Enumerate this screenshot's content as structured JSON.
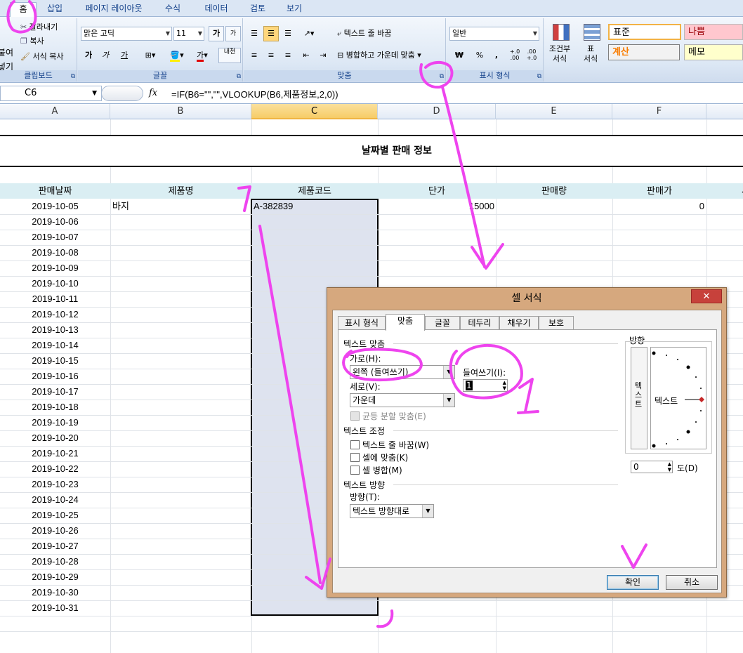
{
  "ribbon_tabs": [
    "홈",
    "삽입",
    "페이지 레이아웃",
    "수식",
    "데이터",
    "검토",
    "보기"
  ],
  "clipboard": {
    "cut": "잘라내기",
    "copy": "복사",
    "format_painter": "서식 복사",
    "paste": "붙여넣기",
    "label": "클립보드"
  },
  "font": {
    "name": "맑은 고딕",
    "size": "11",
    "grow": "가",
    "shrink": "가",
    "bold": "가",
    "italic": "가",
    "underline": "가",
    "phonetic": "내천",
    "label": "글꼴"
  },
  "alignment": {
    "wrap_text": "텍스트 줄 바꿈",
    "merge_center": "병합하고 가운데 맞춤",
    "label": "맞춤"
  },
  "number": {
    "format": "일반",
    "currency": "₩",
    "percent": "%",
    "comma": ",",
    "inc_decimal": "+.0\n.00",
    "dec_decimal": ".00\n+.0",
    "label": "표시 형식"
  },
  "styles": {
    "conditional": "조건부\n서식",
    "table": "표\n서식",
    "normal": "표준",
    "bad": "나쁨",
    "calc": "계산",
    "memo": "메모"
  },
  "formula_bar": {
    "name_box": "C6",
    "fx": "fx",
    "formula": "=IF(B6=\"\",\"\",VLOOKUP(B6,제품정보,2,0))"
  },
  "columns": [
    "A",
    "B",
    "C",
    "D",
    "E",
    "F"
  ],
  "sheet": {
    "title": "날짜별 판매 정보",
    "headers": [
      "판매날짜",
      "제품명",
      "제품코드",
      "단가",
      "판매량",
      "판매가",
      "세"
    ],
    "first_row": {
      "product": "바지",
      "code": "A-382839",
      "price": "15000",
      "sale": "0"
    },
    "dates": [
      "2019-10-05",
      "2019-10-06",
      "2019-10-07",
      "2019-10-08",
      "2019-10-09",
      "2019-10-10",
      "2019-10-11",
      "2019-10-12",
      "2019-10-13",
      "2019-10-14",
      "2019-10-15",
      "2019-10-16",
      "2019-10-17",
      "2019-10-18",
      "2019-10-19",
      "2019-10-20",
      "2019-10-21",
      "2019-10-22",
      "2019-10-23",
      "2019-10-24",
      "2019-10-25",
      "2019-10-26",
      "2019-10-27",
      "2019-10-28",
      "2019-10-29",
      "2019-10-30",
      "2019-10-31"
    ]
  },
  "dialog": {
    "title": "셀 서식",
    "close": "✕",
    "tabs": [
      "표시 형식",
      "맞춤",
      "글꼴",
      "테두리",
      "채우기",
      "보호"
    ],
    "text_align_section": "텍스트 맞춤",
    "horizontal_label": "가로(H):",
    "horizontal_value": "왼쪽 (들여쓰기)",
    "indent_label": "들여쓰기(I):",
    "indent_value": "1",
    "vertical_label": "세로(V):",
    "vertical_value": "가운데",
    "distributed": "균등 분할 맞춤(E)",
    "text_control_section": "텍스트 조정",
    "wrap": "텍스트 줄 바꿈(W)",
    "shrink": "셀에 맞춤(K)",
    "merge": "셀 병합(M)",
    "direction_section": "텍스트 방향",
    "direction_label": "방향(T):",
    "direction_value": "텍스트 방향대로",
    "orientation_label": "방향",
    "orientation_vertical_text": "텍스트",
    "orientation_text": "텍스트",
    "degrees_value": "0",
    "degrees_label": "도(D)",
    "ok": "확인",
    "cancel": "취소"
  },
  "annotations": {
    "number_one": "1",
    "color": "#ee44ee"
  }
}
